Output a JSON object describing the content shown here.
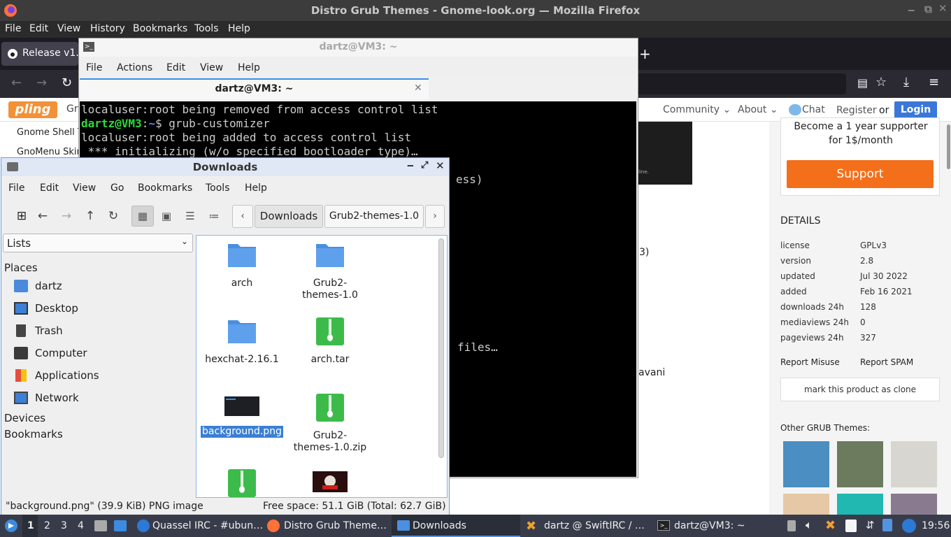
{
  "firefox": {
    "window_title": "Distro Grub Themes - Gnome-look.org — Mozilla Firefox",
    "menu": [
      "File",
      "Edit",
      "View",
      "History",
      "Bookmarks",
      "Tools",
      "Help"
    ],
    "tab_label": "Release v1.",
    "new_tab_symbol": "+"
  },
  "website": {
    "logo": "pling",
    "nav_partial": "Gr",
    "nav": {
      "community": "Community ⌄",
      "about": "About ⌄",
      "chat": "Chat",
      "register": "Register",
      "or": "or",
      "login": "Login"
    },
    "sidebar_links": [
      "Gnome Shell Th",
      "GnoMenu Skin"
    ],
    "fragments": {
      "line": "line.",
      "paren": "3)",
      "avani": "avani"
    },
    "supporter_text": "Become a 1 year supporter for 1$/month",
    "support_button": "Support",
    "details_heading": "DETAILS",
    "details": [
      {
        "key": "license",
        "value": "GPLv3"
      },
      {
        "key": "version",
        "value": "2.8"
      },
      {
        "key": "updated",
        "value": "Jul 30 2022"
      },
      {
        "key": "added",
        "value": "Feb 16 2021"
      },
      {
        "key": "downloads 24h",
        "value": "128"
      },
      {
        "key": "mediaviews 24h",
        "value": "0"
      },
      {
        "key": "pageviews 24h",
        "value": "327"
      }
    ],
    "report_misuse": "Report Misuse",
    "report_spam": "Report SPAM",
    "clone_button": "mark this product as clone",
    "other_heading": "Other GRUB Themes:"
  },
  "terminal": {
    "title": "dartz@VM3: ~",
    "menu": [
      "File",
      "Actions",
      "Edit",
      "View",
      "Help"
    ],
    "tab_title": "dartz@VM3: ~",
    "lines": [
      {
        "text": "localuser:root being removed from access control list"
      },
      {
        "user": "dartz@VM3",
        "path": "~",
        "cmd": "$ grub-customizer"
      },
      {
        "text": "localuser:root being added to access control list"
      },
      {
        "text": " *** initializing (w/o specified bootloader type)…"
      }
    ],
    "partial_1": "ess)",
    "partial_2": "files…"
  },
  "file_manager": {
    "title": "Downloads",
    "menu": [
      "File",
      "Edit",
      "View",
      "Go",
      "Bookmarks",
      "Tools",
      "Help"
    ],
    "path_buttons": [
      "Downloads",
      "Grub2-themes-1.0"
    ],
    "side_pane_select": "Lists",
    "places_heading": "Places",
    "places": [
      "dartz",
      "Desktop",
      "Trash",
      "Computer",
      "Applications",
      "Network"
    ],
    "devices_heading": "Devices",
    "bookmarks_heading": "Bookmarks",
    "files": [
      {
        "name": "arch",
        "type": "folder"
      },
      {
        "name": "Grub2-\nthemes-1.0",
        "type": "folder"
      },
      {
        "name": "hexchat-2.16.1",
        "type": "folder"
      },
      {
        "name": "arch.tar",
        "type": "archive"
      },
      {
        "name": "background.png",
        "type": "image",
        "selected": true
      },
      {
        "name": "Grub2-\nthemes-1.0.zip",
        "type": "archive"
      },
      {
        "name": "",
        "type": "archive"
      },
      {
        "name": "",
        "type": "image"
      }
    ],
    "status_left": "\"background.png\" (39.9 KiB) PNG image",
    "status_right": "Free space: 51.1 GiB (Total: 62.7 GiB)"
  },
  "taskbar": {
    "workspaces": [
      "1",
      "2",
      "3",
      "4"
    ],
    "windows": [
      {
        "label": "Quassel IRC - #ubun…",
        "icon": "quassel-icon"
      },
      {
        "label": "Distro Grub Theme…",
        "icon": "firefox-icon"
      },
      {
        "label": "Downloads",
        "icon": "folder-icon",
        "active": true
      },
      {
        "label": "dartz @ SwiftIRC / …",
        "icon": "hexchat-icon"
      },
      {
        "label": "dartz@VM3: ~",
        "icon": "terminal-icon"
      }
    ],
    "clock": "19:56"
  },
  "colors": {
    "accent": "#3c8ee8",
    "support_orange": "#f46f1a",
    "login_blue": "#3b77d8",
    "taskbar": "#383c4a"
  }
}
